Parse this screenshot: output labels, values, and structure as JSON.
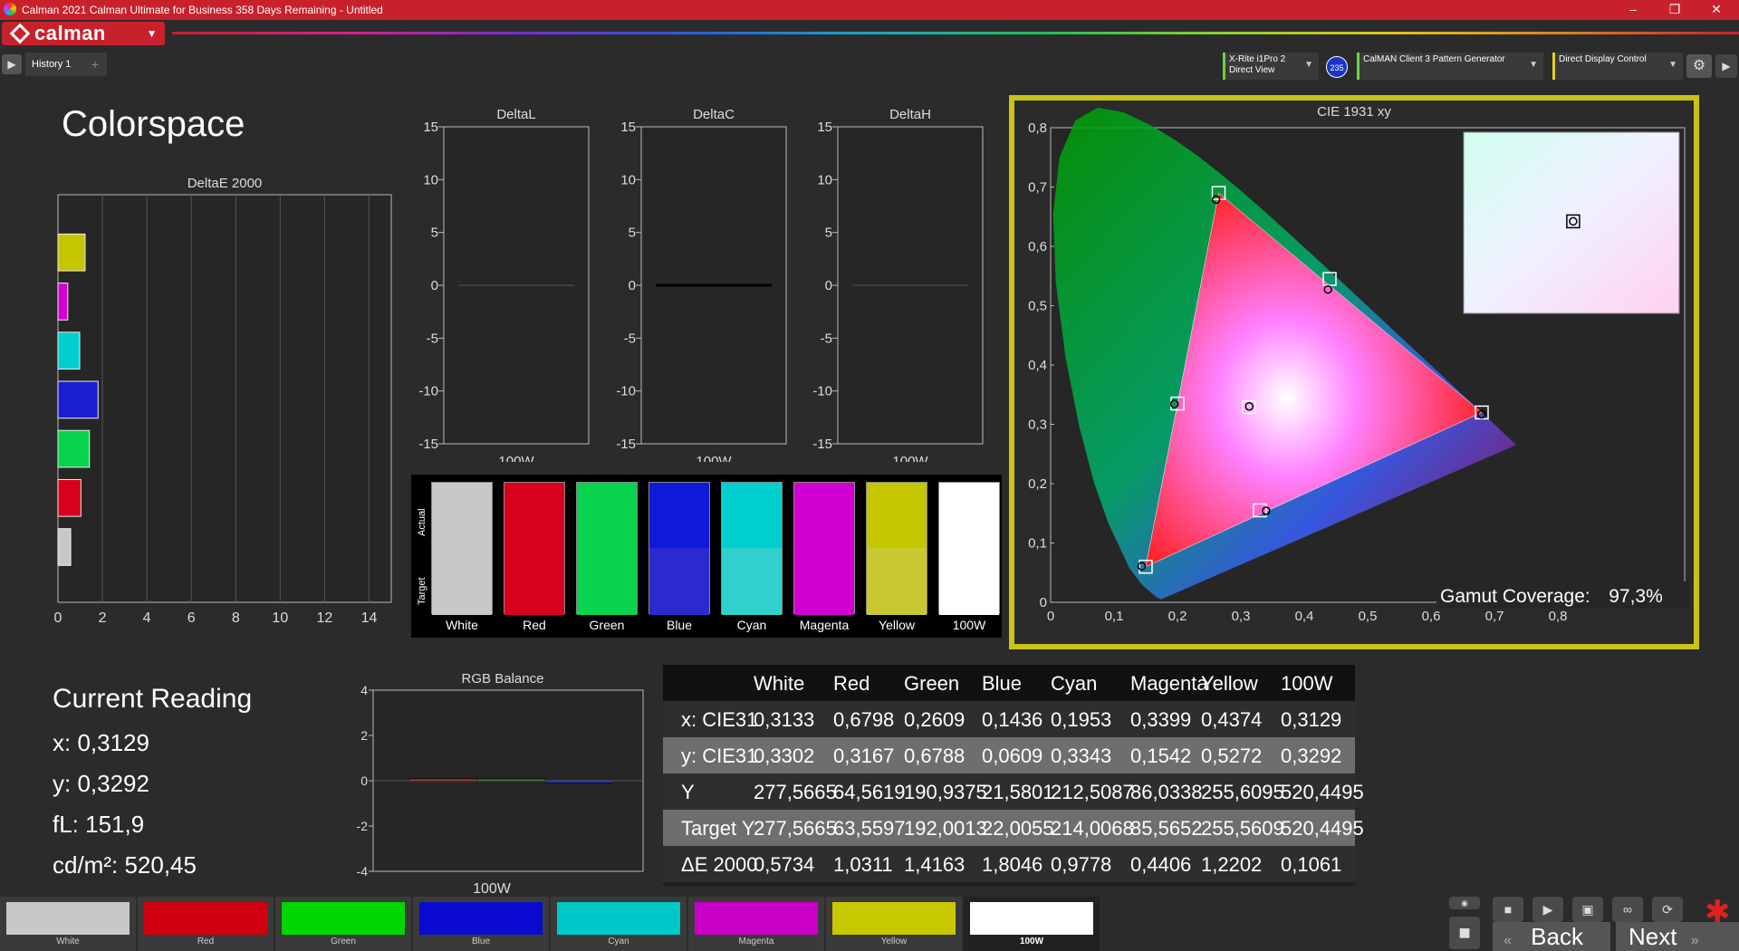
{
  "window": {
    "title": "Calman 2021 Calman Ultimate for Business 358 Days Remaining  - Untitled",
    "minimize": "–",
    "restore": "❐",
    "close": "✕"
  },
  "logo": {
    "text": "calman",
    "dropdown": "▼"
  },
  "tabs": {
    "history": "History 1",
    "add": "+"
  },
  "devices": [
    {
      "line1": "X-Rite i1Pro 2",
      "line2": "Direct View"
    },
    {
      "line1": "CalMAN Client 3 Pattern Generator",
      "line2": ""
    },
    {
      "line1": "Direct Display Control",
      "line2": ""
    }
  ],
  "badge": "235",
  "page_title": "Colorspace",
  "colors": {
    "white": "#c8c8c8",
    "red": "#d9001e",
    "green": "#08d24e",
    "blue": "#1a1ed2",
    "cyan": "#00cfcf",
    "magenta": "#d100d1",
    "yellow": "#c4c600",
    "w100": "#ffffff",
    "accent_frame": "#c8c418",
    "titlebar": "#c9212c"
  },
  "deltae_chart": {
    "title": "DeltaE 2000",
    "xticks": [
      "0",
      "2",
      "4",
      "6",
      "8",
      "10",
      "12",
      "14"
    ],
    "values": [
      1.2202,
      0.4406,
      0.9778,
      1.8046,
      1.4163,
      1.0311,
      0.5734
    ],
    "bar_colors": [
      "#c4c600",
      "#d100d1",
      "#00cfcf",
      "#1a1ed2",
      "#08d24e",
      "#d9001e",
      "#c8c8c8"
    ]
  },
  "small_charts": [
    {
      "title": "DeltaL",
      "category": "100W",
      "value": 0
    },
    {
      "title": "DeltaC",
      "category": "100W",
      "value": 0
    },
    {
      "title": "DeltaH",
      "category": "100W",
      "value": 0
    }
  ],
  "small_yticks": [
    "15",
    "10",
    "5",
    "0",
    "-5",
    "-10",
    "-15"
  ],
  "swatch_panel": {
    "side_actual": "Actual",
    "side_target": "Target",
    "items": [
      {
        "label": "White",
        "actual": "#c8c8c8",
        "target": "#c8c8c8"
      },
      {
        "label": "Red",
        "actual": "#d9001e",
        "target": "#d9001e"
      },
      {
        "label": "Green",
        "actual": "#08d24e",
        "target": "#08d24e"
      },
      {
        "label": "Blue",
        "actual": "#0e1ad8",
        "target": "#2a2ad0"
      },
      {
        "label": "Cyan",
        "actual": "#00cfcf",
        "target": "#30d0cc"
      },
      {
        "label": "Magenta",
        "actual": "#d100d1",
        "target": "#d100d1"
      },
      {
        "label": "Yellow",
        "actual": "#c4c600",
        "target": "#c8c830"
      },
      {
        "label": "100W",
        "actual": "#ffffff",
        "target": "#ffffff"
      }
    ]
  },
  "current_reading": {
    "title": "Current Reading",
    "x": "x: 0,3129",
    "y": "y: 0,3292",
    "fl": "fL: 151,9",
    "cdm2": "cd/m²: 520,45"
  },
  "rgb_balance": {
    "title": "RGB Balance",
    "category": "100W",
    "yticks": [
      "4",
      "2",
      "0",
      "-2",
      "-4"
    ],
    "red": 0.1,
    "green": 0.0,
    "blue": -0.1
  },
  "table": {
    "headers": [
      "",
      "White",
      "Red",
      "Green",
      "Blue",
      "Cyan",
      "Magenta",
      "Yellow",
      "100W"
    ],
    "rows": [
      [
        "x: CIE31",
        "0,3133",
        "0,6798",
        "0,2609",
        "0,1436",
        "0,1953",
        "0,3399",
        "0,4374",
        "0,3129"
      ],
      [
        "y: CIE31",
        "0,3302",
        "0,3167",
        "0,6788",
        "0,0609",
        "0,3343",
        "0,1542",
        "0,5272",
        "0,3292"
      ],
      [
        "Y",
        "277,5665",
        "64,5619",
        "190,9375",
        "21,5801",
        "212,5087",
        "86,0338",
        "255,6095",
        "520,4495"
      ],
      [
        "Target Y",
        "277,5665",
        "63,5597",
        "192,0013",
        "22,0055",
        "214,0068",
        "85,5652",
        "255,5609",
        "520,4495"
      ],
      [
        "ΔE 2000",
        "0,5734",
        "1,0311",
        "1,4163",
        "1,8046",
        "0,9778",
        "0,4406",
        "1,2202",
        "0,1061"
      ]
    ]
  },
  "chart_data": [
    {
      "type": "bar",
      "title": "DeltaE 2000",
      "categories": [
        "Yellow",
        "Magenta",
        "Cyan",
        "Blue",
        "Green",
        "Red",
        "White"
      ],
      "values": [
        1.2202,
        0.4406,
        0.9778,
        1.8046,
        1.4163,
        1.0311,
        0.5734
      ],
      "xlim": [
        0,
        15
      ]
    },
    {
      "type": "scatter",
      "title": "CIE 1931 xy",
      "xlim": [
        0,
        0.8
      ],
      "ylim": [
        0,
        0.8
      ],
      "xticks": [
        "0",
        "0,1",
        "0,2",
        "0,3",
        "0,4",
        "0,5",
        "0,6",
        "0,7",
        "0,8"
      ],
      "yticks": [
        "0",
        "0,1",
        "0,2",
        "0,3",
        "0,4",
        "0,5",
        "0,6",
        "0,7",
        "0,8"
      ],
      "target_gamut": [
        [
          0.68,
          0.32
        ],
        [
          0.265,
          0.69
        ],
        [
          0.15,
          0.06
        ]
      ],
      "targets": [
        [
          0.3127,
          0.329
        ],
        [
          0.68,
          0.32
        ],
        [
          0.265,
          0.69
        ],
        [
          0.15,
          0.06
        ],
        [
          0.2,
          0.335
        ],
        [
          0.33,
          0.155
        ],
        [
          0.44,
          0.545
        ]
      ],
      "actuals": [
        [
          0.3133,
          0.3302
        ],
        [
          0.6798,
          0.3167
        ],
        [
          0.2609,
          0.6788
        ],
        [
          0.1436,
          0.0609
        ],
        [
          0.1953,
          0.3343
        ],
        [
          0.3399,
          0.1542
        ],
        [
          0.4374,
          0.5272
        ]
      ],
      "inset_point": [
        0.3129,
        0.3292
      ],
      "gamut_coverage_label": "Gamut Coverage:",
      "gamut_coverage": "97,3%"
    }
  ],
  "bottom_swatches": [
    {
      "label": "White",
      "color": "#c8c8c8"
    },
    {
      "label": "Red",
      "color": "#d0000e"
    },
    {
      "label": "Green",
      "color": "#00d600"
    },
    {
      "label": "Blue",
      "color": "#0a0ad0"
    },
    {
      "label": "Cyan",
      "color": "#00c8c8"
    },
    {
      "label": "Magenta",
      "color": "#c800c8"
    },
    {
      "label": "Yellow",
      "color": "#c8c800"
    },
    {
      "label": "100W",
      "color": "#ffffff"
    }
  ],
  "nav": {
    "back": "Back",
    "next": "Next"
  }
}
